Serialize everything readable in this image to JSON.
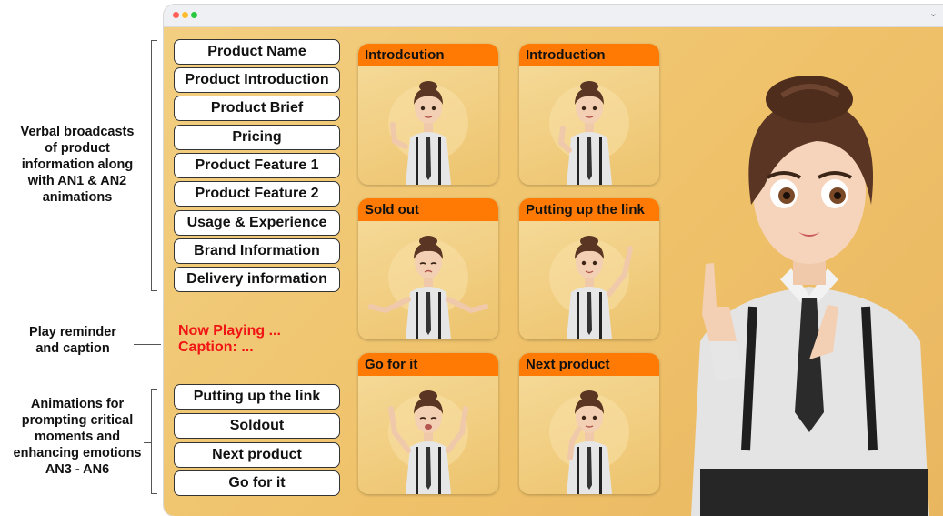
{
  "annotations": {
    "verbal": [
      "Verbal broadcasts",
      "of product",
      "information along",
      "with AN1 & AN2",
      "animations"
    ],
    "reminder": [
      "Play reminder",
      "and caption"
    ],
    "prompting": [
      "Animations for",
      "prompting critical",
      "moments and",
      "enhancing emotions",
      "AN3 - AN6"
    ]
  },
  "window": {
    "traffic_lights": [
      "#ff5f57",
      "#febc2e",
      "#28c840"
    ],
    "chevron_icon": "chevron-down-icon"
  },
  "info_buttons": [
    "Product Name",
    "Product Introduction",
    "Product Brief",
    "Pricing",
    "Product Feature 1",
    "Product Feature 2",
    "Usage & Experience",
    "Brand Information",
    "Delivery information"
  ],
  "status": {
    "now_playing": "Now Playing ...",
    "caption": "Caption: ..."
  },
  "action_buttons": [
    "Putting up the link",
    "Soldout",
    "Next product",
    "Go for it"
  ],
  "cards": [
    "Introdcution",
    "Introduction",
    "Sold out",
    "Putting up the link",
    "Go for it",
    "Next product"
  ],
  "colors": {
    "accent_orange": "#ff7a05",
    "status_red": "#f01414",
    "background_gold": "#efc26a"
  }
}
